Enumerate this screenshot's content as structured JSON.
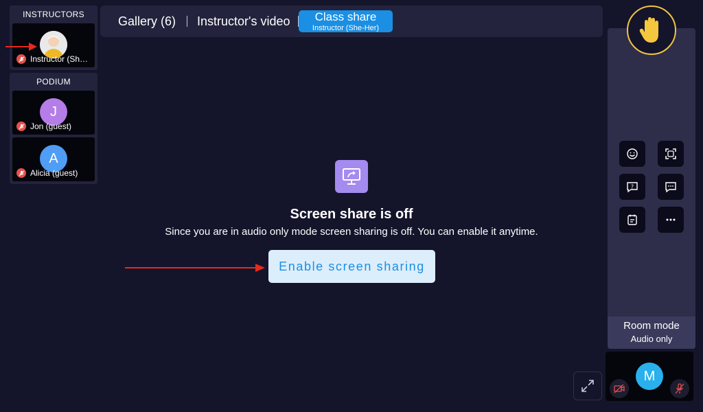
{
  "instructors_panel": {
    "title": "INSTRUCTORS",
    "participants": [
      {
        "name": "Instructor (She-Her)",
        "initial": "",
        "avatar_color": "#d9d9d9",
        "muted": true
      }
    ]
  },
  "podium_panel": {
    "title": "PODIUM",
    "participants": [
      {
        "name": "Jon (guest)",
        "initial": "J",
        "avatar_color": "#b57de8",
        "muted": true
      },
      {
        "name": "Alicia (guest)",
        "initial": "A",
        "avatar_color": "#4f9df5",
        "muted": true
      }
    ]
  },
  "tabs": {
    "gallery": "Gallery (6)",
    "instructor_video": "Instructor's video",
    "class_share": {
      "label": "Class share",
      "sublabel": "Instructor (She-Her)"
    }
  },
  "screen_share": {
    "icon": "screen-share-icon",
    "title": "Screen share is off",
    "message": "Since you are in audio only mode screen sharing is off. You can enable it anytime.",
    "button": "Enable screen sharing"
  },
  "sidebar": {
    "raise_hand_icon": "raised-hand-icon",
    "tools": [
      "emoji-icon",
      "focus-icon",
      "question-icon",
      "chat-icon",
      "notes-icon",
      "more-icon"
    ],
    "room_mode": {
      "label": "Room mode",
      "value": "Audio only"
    }
  },
  "self_view": {
    "initial": "M",
    "avatar_color": "#2ab0ec",
    "camera_off": true,
    "mic_muted": true
  },
  "colors": {
    "background": "#14142b",
    "panel": "#23233d",
    "accent": "#1a8fe3",
    "mute_red": "#e3514c",
    "annotation_red": "#e8291c",
    "hand_gold": "#f3c53d"
  }
}
